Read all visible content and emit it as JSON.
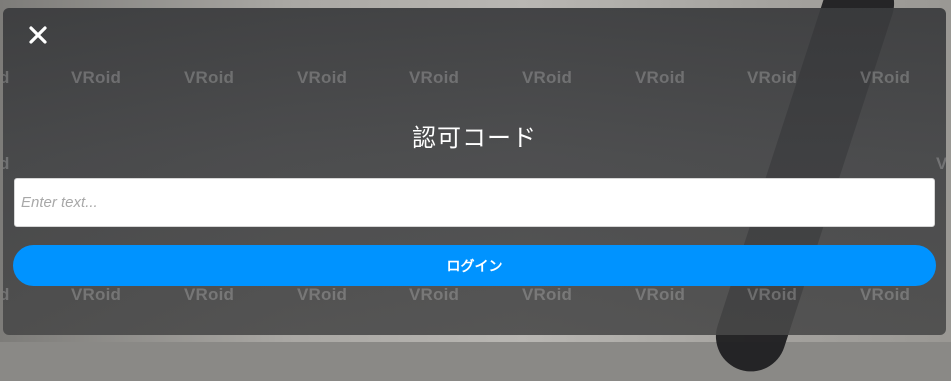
{
  "dialog": {
    "close_icon": "close-icon",
    "title": "認可コード",
    "input": {
      "placeholder": "Enter text...",
      "value": ""
    },
    "login_label": "ログイン",
    "accent_color": "#0093ff"
  },
  "watermarks": {
    "text": "VRoid",
    "partial": "d"
  }
}
